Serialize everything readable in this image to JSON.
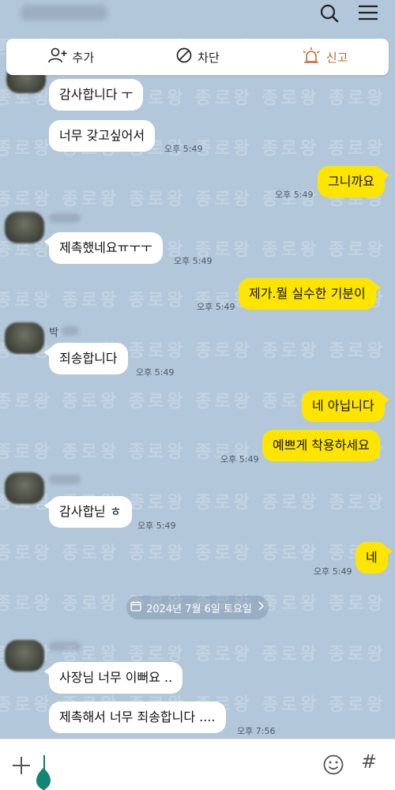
{
  "header": {
    "icons": [
      "search-icon",
      "menu-icon"
    ]
  },
  "action_bar": {
    "add_label": "추가",
    "block_label": "차단",
    "report_label": "신고",
    "report_color": "#c26a2e"
  },
  "watermark_text": "종로왕 종로왕 종로왕 종로왕 종로왕 종로왕",
  "colors": {
    "background": "#b2c7da",
    "incoming_bubble": "#ffffff",
    "outgoing_bubble": "#fee500"
  },
  "messages": [
    {
      "text": "감사합니다 ㅜ",
      "time": ""
    },
    {
      "text": "너무 갖고싶어서",
      "time": "오후 5:49"
    },
    {
      "text": "그니까요",
      "time": "오후 5:49"
    },
    {
      "text": "제촉했네요ㅠㅜㅜ",
      "time": "오후 5:49"
    },
    {
      "text": "제가.뭘 실수한 기분이",
      "time": "오후 5:49"
    },
    {
      "text": "죄송합니다",
      "time": "오후 5:49"
    },
    {
      "text": "네 아닙니다",
      "time": ""
    },
    {
      "text": "예쁘게 착용하세요",
      "time": "오후 5:49"
    },
    {
      "text": "감사합닏 ㅎ",
      "time": "오후 5:49"
    },
    {
      "text": "네",
      "time": "오후 5:49"
    },
    {
      "text": "사장님 너무 이뻐요 ..",
      "time": ""
    },
    {
      "text": "제촉해서 너무 죄송합니다 ....",
      "time": "오후 7:56"
    }
  ],
  "senders": {
    "third_group_prefix": "박"
  },
  "date_divider": "2024년 7월 6일 토요일",
  "input": {
    "value": "",
    "icons": [
      "plus-icon",
      "emoji-icon",
      "hashtag-icon"
    ],
    "hash_label": "#"
  }
}
